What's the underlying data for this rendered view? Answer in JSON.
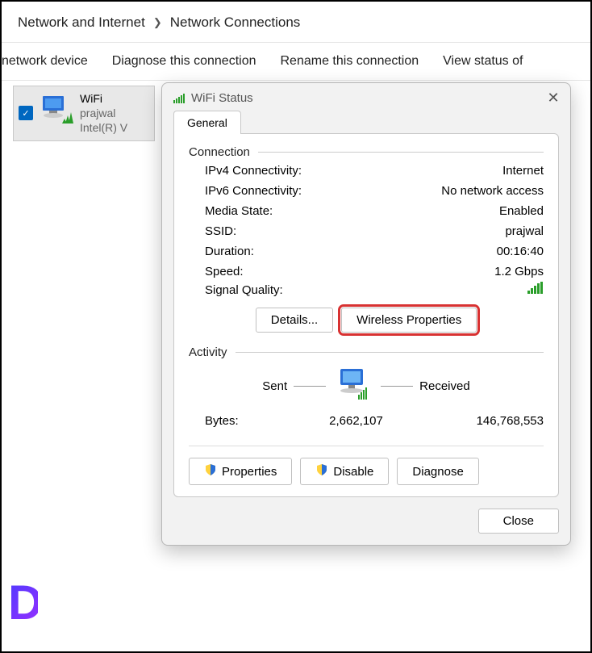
{
  "breadcrumb": {
    "parent": "Network and Internet",
    "current": "Network Connections"
  },
  "toolbar": {
    "item1": "network device",
    "item2": "Diagnose this connection",
    "item3": "Rename this connection",
    "item4": "View status of"
  },
  "adapter": {
    "name": "WiFi",
    "ssid": "prajwal",
    "driver": "Intel(R) V"
  },
  "dialog": {
    "title": "WiFi Status",
    "tab": "General",
    "connection": {
      "label": "Connection",
      "ipv4_label": "IPv4 Connectivity:",
      "ipv4_value": "Internet",
      "ipv6_label": "IPv6 Connectivity:",
      "ipv6_value": "No network access",
      "media_label": "Media State:",
      "media_value": "Enabled",
      "ssid_label": "SSID:",
      "ssid_value": "prajwal",
      "duration_label": "Duration:",
      "duration_value": "00:16:40",
      "speed_label": "Speed:",
      "speed_value": "1.2 Gbps",
      "signal_label": "Signal Quality:"
    },
    "buttons": {
      "details": "Details...",
      "wireless_props": "Wireless Properties"
    },
    "activity": {
      "label": "Activity",
      "sent": "Sent",
      "received": "Received",
      "bytes_label": "Bytes:",
      "bytes_sent": "2,662,107",
      "bytes_received": "146,768,553"
    },
    "bottom_buttons": {
      "properties": "Properties",
      "disable": "Disable",
      "diagnose": "Diagnose"
    },
    "close": "Close"
  }
}
